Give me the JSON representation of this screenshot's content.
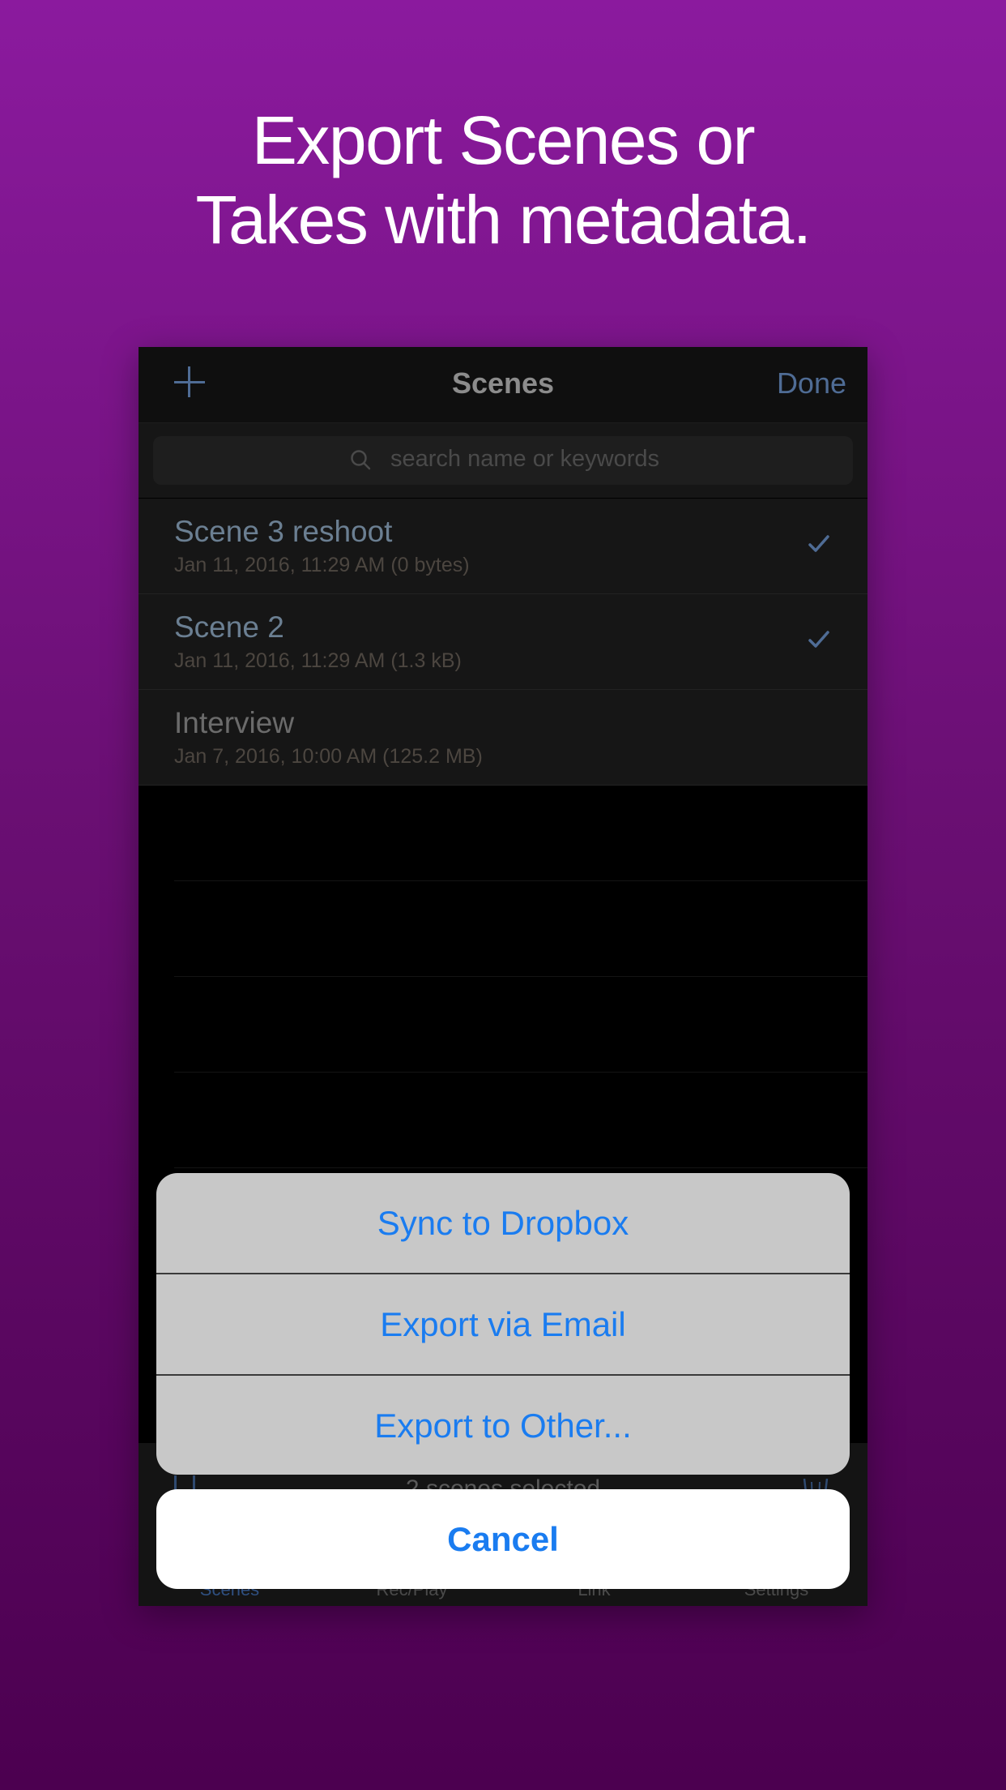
{
  "headline": {
    "line1": "Export Scenes or",
    "line2": "Takes with metadata."
  },
  "navbar": {
    "title": "Scenes",
    "done_label": "Done"
  },
  "search": {
    "placeholder": "search name or keywords"
  },
  "scenes": [
    {
      "title": "Scene 3 reshoot",
      "subtitle": "Jan 11, 2016, 11:29 AM  (0 bytes)",
      "selected": true
    },
    {
      "title": "Scene 2",
      "subtitle": "Jan 11, 2016, 11:29 AM  (1.3 kB)",
      "selected": true
    },
    {
      "title": "Interview",
      "subtitle": "Jan 7, 2016, 10:00 AM  (125.2 MB)",
      "selected": false
    }
  ],
  "toolbar": {
    "selection_text": "2 scenes selected"
  },
  "tabs": [
    {
      "label": "Scenes",
      "active": true
    },
    {
      "label": "Rec/Play",
      "active": false
    },
    {
      "label": "Link",
      "active": false
    },
    {
      "label": "Settings",
      "active": false
    }
  ],
  "action_sheet": {
    "items": [
      "Sync to Dropbox",
      "Export via Email",
      "Export to Other..."
    ],
    "cancel_label": "Cancel"
  },
  "colors": {
    "accent": "#1a7cf0",
    "nav_tint": "#4f6c95",
    "background_top": "#8b1a9e",
    "background_bottom": "#4c0050"
  },
  "icons": {
    "add": "plus-icon",
    "search": "search-icon",
    "check": "checkmark-icon",
    "delete": "trash-icon"
  }
}
